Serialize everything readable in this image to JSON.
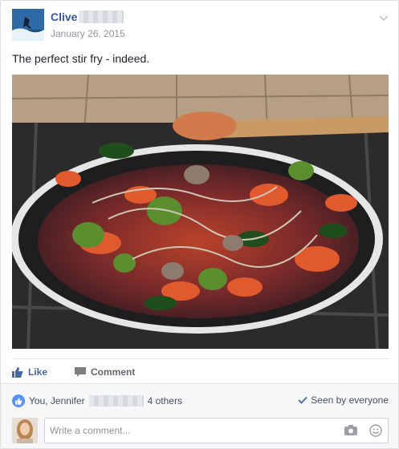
{
  "post": {
    "author_name": "Clive",
    "date": "January 26, 2015",
    "text": "The perfect stir fry - indeed."
  },
  "actions": {
    "like_label": "Like",
    "comment_label": "Comment"
  },
  "likes": {
    "text_prefix": "You, Jennifer",
    "text_suffix": "4 others"
  },
  "seen": {
    "label": "Seen by everyone"
  },
  "comment_box": {
    "placeholder": "Write a comment..."
  },
  "icons": {
    "menu": "chevron-down-icon",
    "like": "thumbs-up-icon",
    "comment": "speech-bubble-icon",
    "seen": "check-icon",
    "camera": "camera-icon",
    "emoji": "smiley-icon"
  },
  "colors": {
    "link": "#365899",
    "like_blue": "#4b67a1",
    "like_badge": "#5890ff"
  }
}
